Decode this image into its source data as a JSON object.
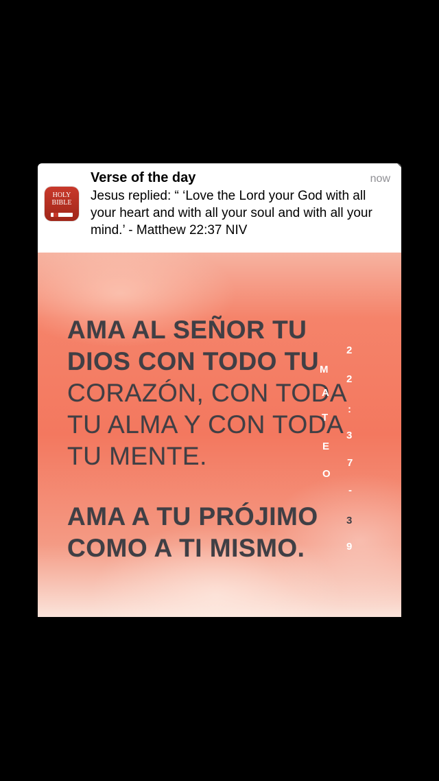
{
  "notification": {
    "title": "Verse of the day",
    "time": "now",
    "body": "Jesus replied: “ ‘Love the Lord your God with all your heart and with all your soul and with all your mind.’ - Matthew 22:37 NIV",
    "app_icon": {
      "name": "holy-bible-app-icon",
      "line1": "HOLY",
      "line2": "BIBLE",
      "color": "#c8392b"
    }
  },
  "poster": {
    "lines": [
      "AMA  AL  SEÑOR  TU",
      "DIOS  CON  TODO  TU",
      "CORAZÓN,  CON  TODA",
      "TU ALMA Y CON TODA",
      "TU MENTE.",
      "AMA  A  TU  PRÓJIMO",
      "COMO A TI MISMO."
    ],
    "reference_letters": [
      "M",
      "A",
      "T",
      "E",
      "O"
    ],
    "reference_digits": [
      "2",
      "2",
      ":",
      "3",
      "7",
      "-",
      "3",
      "9"
    ],
    "colors": {
      "text": "#3f3f45",
      "background": "#f3785f"
    }
  }
}
